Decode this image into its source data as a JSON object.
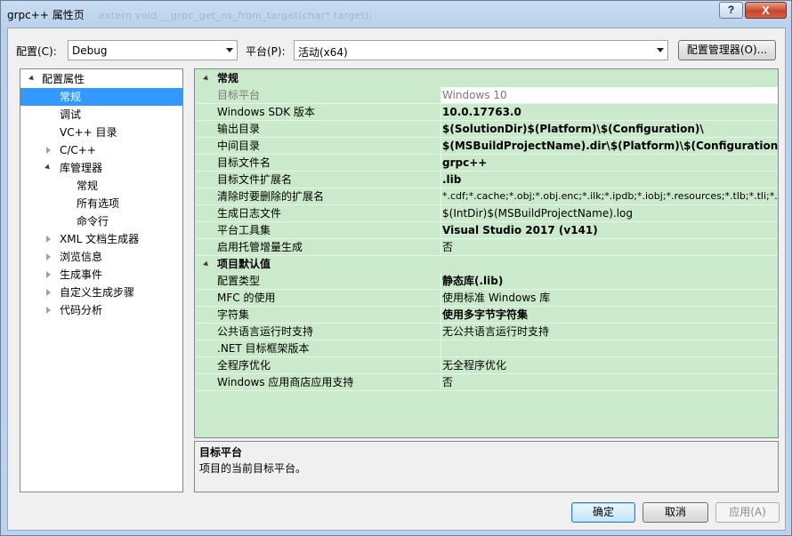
{
  "window": {
    "title": "grpc++ 属性页",
    "ghost_text": "extern void __grpc_get_ns_from_target(char* target);",
    "help_label": "?",
    "close_label": "X"
  },
  "toolbar": {
    "config_label": "配置(C):",
    "config_value": "Debug",
    "platform_label": "平台(P):",
    "platform_value": "活动(x64)",
    "config_manager_label": "配置管理器(O)..."
  },
  "tree": {
    "root": "配置属性",
    "items": [
      {
        "label": "常规",
        "selected": true
      },
      {
        "label": "调试"
      },
      {
        "label": "VC++ 目录"
      },
      {
        "label": "C/C++"
      },
      {
        "label": "库管理器"
      },
      {
        "label": "常规"
      },
      {
        "label": "所有选项"
      },
      {
        "label": "命令行"
      },
      {
        "label": "XML 文档生成器"
      },
      {
        "label": "浏览信息"
      },
      {
        "label": "生成事件"
      },
      {
        "label": "自定义生成步骤"
      },
      {
        "label": "代码分析"
      }
    ]
  },
  "grid": {
    "categories": [
      {
        "name": "常规"
      },
      {
        "name": "项目默认值"
      }
    ],
    "general": [
      {
        "name": "目标平台",
        "value": "Windows 10"
      },
      {
        "name": "Windows SDK 版本",
        "value": "10.0.17763.0"
      },
      {
        "name": "输出目录",
        "value": "$(SolutionDir)$(Platform)\\$(Configuration)\\"
      },
      {
        "name": "中间目录",
        "value": "$(MSBuildProjectName).dir\\$(Platform)\\$(Configuration)\\"
      },
      {
        "name": "目标文件名",
        "value": "grpc++"
      },
      {
        "name": "目标文件扩展名",
        "value": ".lib"
      },
      {
        "name": "清除时要删除的扩展名",
        "value": "*.cdf;*.cache;*.obj;*.obj.enc;*.ilk;*.ipdb;*.iobj;*.resources;*.tlb;*.tli;*.tl"
      },
      {
        "name": "生成日志文件",
        "value": "$(IntDir)$(MSBuildProjectName).log"
      },
      {
        "name": "平台工具集",
        "value": "Visual Studio 2017 (v141)"
      },
      {
        "name": "启用托管增量生成",
        "value": "否"
      }
    ],
    "defaults": [
      {
        "name": "配置类型",
        "value": "静态库(.lib)"
      },
      {
        "name": "MFC 的使用",
        "value": "使用标准 Windows 库"
      },
      {
        "name": "字符集",
        "value": "使用多字节字符集"
      },
      {
        "name": "公共语言运行时支持",
        "value": "无公共语言运行时支持"
      },
      {
        "name": ".NET 目标框架版本",
        "value": ""
      },
      {
        "name": "全程序优化",
        "value": "无全程序优化"
      },
      {
        "name": "Windows 应用商店应用支持",
        "value": "否"
      }
    ]
  },
  "description": {
    "title": "目标平台",
    "text": "项目的当前目标平台。"
  },
  "buttons": {
    "ok": "确定",
    "cancel": "取消",
    "apply": "应用(A)"
  }
}
